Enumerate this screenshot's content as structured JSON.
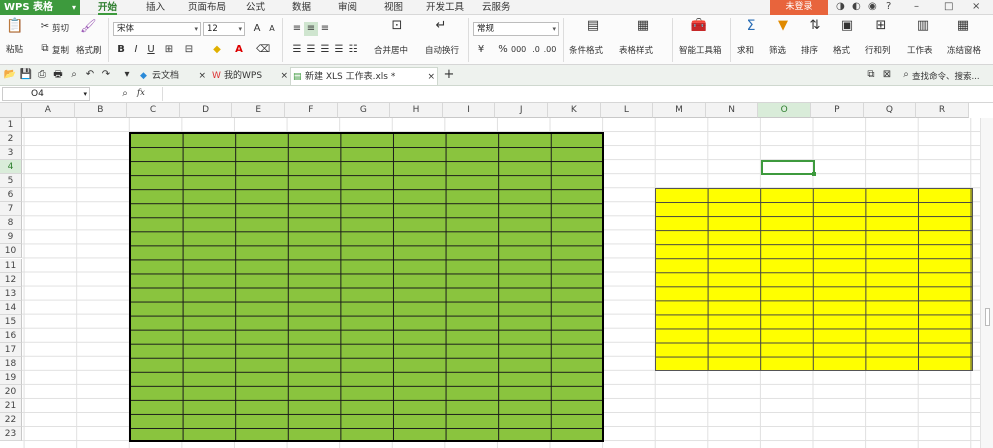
{
  "app": {
    "title": "WPS 表格"
  },
  "menu": [
    "开始",
    "插入",
    "页面布局",
    "公式",
    "数据",
    "审阅",
    "视图",
    "开发工具",
    "云服务"
  ],
  "login_label": "未登录",
  "window_controls": [
    "?",
    "–",
    "□",
    "×"
  ],
  "ribbon": {
    "paste": "粘贴",
    "cut": "剪切",
    "copy": "复制",
    "format_painter": "格式刷",
    "font_name": "宋体",
    "font_size": "12",
    "merge_center": "合并居中",
    "auto_wrap": "自动换行",
    "number_format": "常规",
    "conditional_format": "条件格式",
    "table_style": "表格样式",
    "smart_toolbox": "智能工具箱",
    "sum": "求和",
    "filter": "筛选",
    "sort": "排序",
    "format": "格式",
    "row_col": "行和列",
    "worksheet": "工作表",
    "freeze_panes": "冻结窗格"
  },
  "doc_tabs": [
    {
      "label": "云文档"
    },
    {
      "label": "我的WPS"
    },
    {
      "label": "新建 XLS 工作表.xls *"
    }
  ],
  "search_cmd": "查找命令、搜索...",
  "name_box": "O4",
  "fx_label": "fx",
  "columns": [
    "A",
    "B",
    "C",
    "D",
    "E",
    "F",
    "G",
    "H",
    "I",
    "J",
    "K",
    "L",
    "M",
    "N",
    "O",
    "P",
    "Q",
    "R"
  ],
  "rows": [
    "1",
    "2",
    "3",
    "4",
    "5",
    "6",
    "7",
    "8",
    "9",
    "10",
    "11",
    "12",
    "13",
    "14",
    "15",
    "16",
    "17",
    "18",
    "19",
    "20",
    "21",
    "22",
    "23"
  ],
  "selected_cell": "O4",
  "fills": {
    "green": "#8ac43e",
    "yellow": "#ffff00",
    "accent": "#3d9a3d"
  }
}
